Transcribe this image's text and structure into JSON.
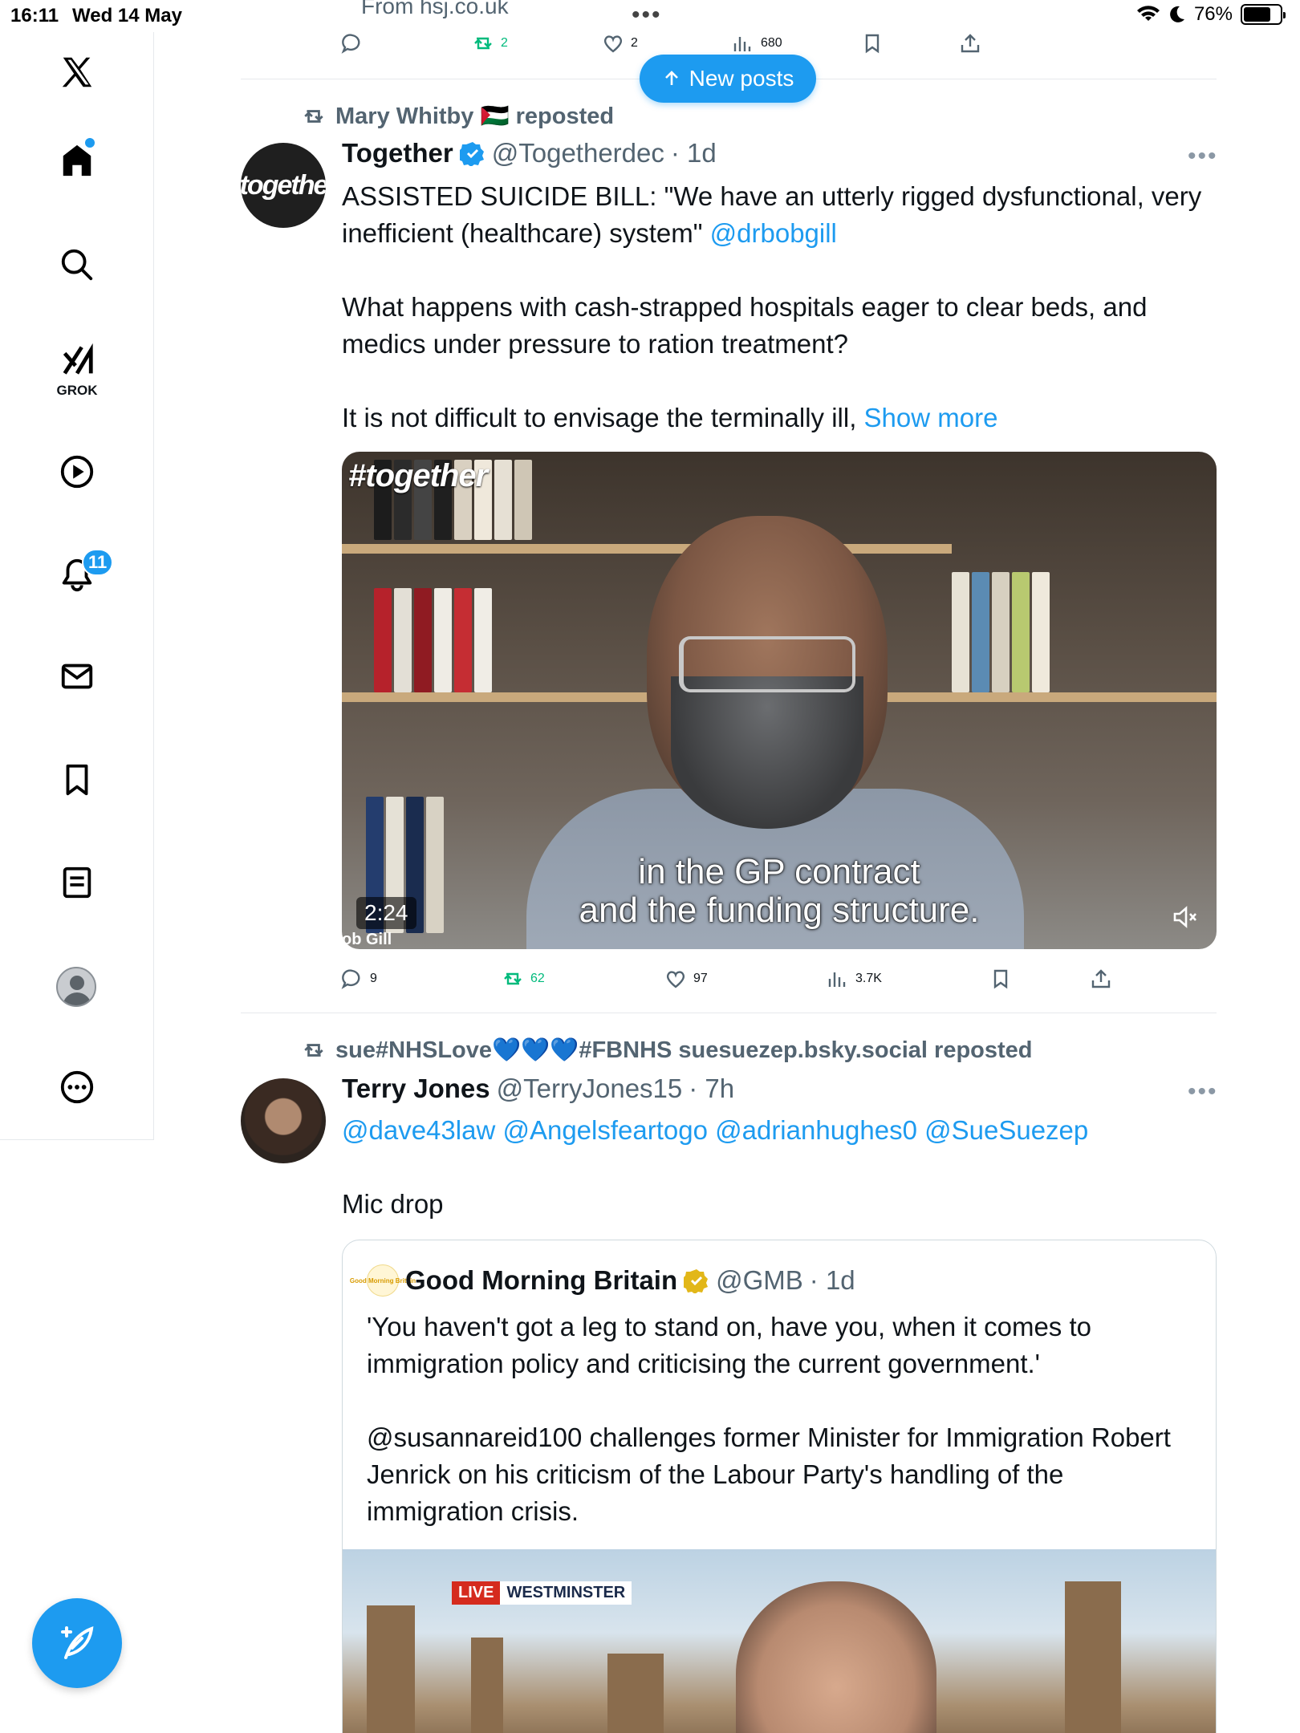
{
  "status_bar": {
    "time": "16:11",
    "date": "Wed 14 May",
    "more_dots": "•••",
    "battery": "76%",
    "battery_level": 0.76
  },
  "sidebar": {
    "items": [
      {
        "name": "x-logo-icon"
      },
      {
        "name": "home-icon"
      },
      {
        "name": "search-icon"
      },
      {
        "name": "grok-icon",
        "label": "GROK"
      },
      {
        "name": "video-icon"
      },
      {
        "name": "notifications-icon",
        "badge": "11"
      },
      {
        "name": "messages-icon"
      },
      {
        "name": "bookmarks-icon"
      },
      {
        "name": "lists-icon"
      },
      {
        "name": "profile-avatar-icon"
      },
      {
        "name": "more-icon"
      }
    ]
  },
  "top_post": {
    "source": "From hsj.co.uk",
    "actions": {
      "reply": "",
      "reposts": "2",
      "likes": "2",
      "views": "680"
    }
  },
  "new_posts_button": "New posts",
  "post1": {
    "repost_by": "Mary Whitby 🇵🇸 reposted",
    "author": "Together",
    "handle": "@Togetherdec",
    "time": "· 1d",
    "avatar_text": "togethe",
    "text_line1": "ASSISTED SUICIDE BILL: \"We have an utterly rigged dysfunctional, very inefficient (healthcare) system\"",
    "mention": "@drbobgill",
    "para2": "What happens with cash-strapped hospitals eager to clear beds, and medics under pressure to ration treatment?",
    "para3": "It is not difficult to envisage the terminally ill,",
    "show_more": "Show more",
    "video": {
      "tag": "#together",
      "subtitle_line1": "in the GP contract",
      "subtitle_line2": "and the funding structure.",
      "duration": "2:24",
      "lower_name": "ob Gill"
    },
    "actions": {
      "replies": "9",
      "reposts": "62",
      "likes": "97",
      "views": "3.7K"
    }
  },
  "post2": {
    "repost_by": "sue#NHSLove💙💙💙#FBNHS suesuezep.bsky.social reposted",
    "author": "Terry Jones",
    "handle": "@TerryJones15",
    "time": "· 7h",
    "mentions": "@dave43law @Angelsfeartogo @adrianhughes0 @SueSuezep",
    "text": "Mic drop",
    "quote": {
      "logo_text": "Good Morning Britain",
      "author": "Good Morning Britain",
      "handle": "@GMB",
      "time": "· 1d",
      "text1": "'You haven't got a leg to stand on, have you, when it comes to immigration policy and criticising the current government.'",
      "text2": "@susannareid100 challenges former Minister for Immigration Robert Jenrick on his criticism of the Labour Party's handling of the immigration crisis.",
      "live": "LIVE",
      "location": "WESTMINSTER"
    }
  },
  "colors": {
    "accent": "#1d9bf0",
    "repost_green": "#00ba7c",
    "muted": "#536471",
    "verified_gold": "#e2b719"
  }
}
